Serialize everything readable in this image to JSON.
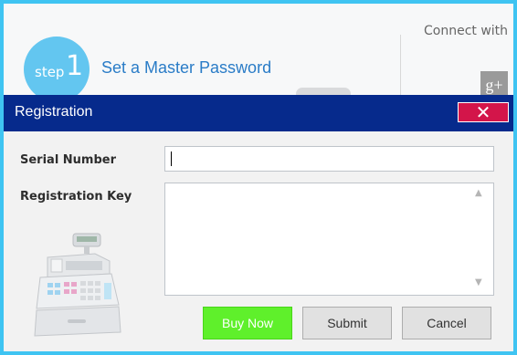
{
  "background_app": {
    "step_word": "step",
    "step_number": "1",
    "step_title": "Set a Master Password",
    "connect_text": "Connect with",
    "gplus_icon": "g+"
  },
  "dialog": {
    "title": "Registration",
    "close_glyph": "✕",
    "serial_label": "Serial Number",
    "serial_value": "",
    "key_label": "Registration Key",
    "key_value": "",
    "scroll_up": "▲",
    "scroll_down": "▼",
    "buttons": {
      "buy": "Buy Now",
      "submit": "Submit",
      "cancel": "Cancel"
    }
  },
  "colors": {
    "outer_border": "#3fc4f2",
    "titlebar": "#062a8c",
    "close": "#d3154a",
    "buy": "#5ff02b"
  },
  "icons": [
    "cash-register-icon",
    "close-icon",
    "google-plus-icon"
  ]
}
